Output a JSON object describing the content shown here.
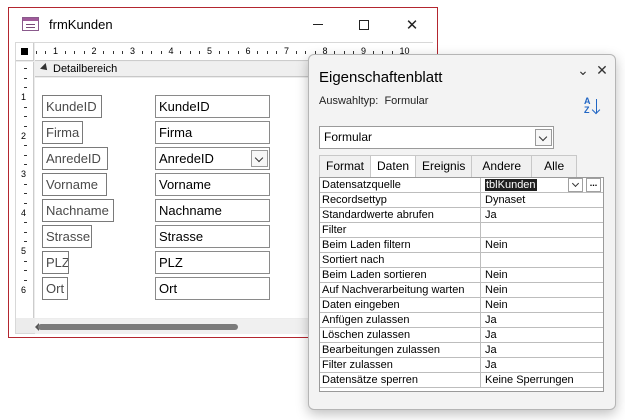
{
  "form_window": {
    "title": "frmKunden",
    "section": "Detailbereich",
    "ruler_h": [
      "1",
      "2",
      "3",
      "4",
      "5",
      "6",
      "7",
      "8",
      "9",
      "10"
    ],
    "ruler_v": [
      "1",
      "2",
      "3",
      "4",
      "5",
      "6"
    ],
    "labels": [
      "KundeID",
      "Firma",
      "AnredeID",
      "Vorname",
      "Nachname",
      "Strasse",
      "PLZ",
      "Ort"
    ],
    "fields": [
      "KundeID",
      "Firma",
      "AnredeID",
      "Vorname",
      "Nachname",
      "Strasse",
      "PLZ",
      "Ort"
    ]
  },
  "property_sheet": {
    "title": "Eigenschaftenblatt",
    "selection_type_label": "Auswahltyp:",
    "selection_type_value": "Formular",
    "sort_icon_text": "A Z",
    "object_select": "Formular",
    "tabs": [
      "Format",
      "Daten",
      "Ereignis",
      "Andere",
      "Alle"
    ],
    "active_tab": "Daten",
    "rows": [
      {
        "name": "Datensatzquelle",
        "value": "tblKunden"
      },
      {
        "name": "Recordsettyp",
        "value": "Dynaset"
      },
      {
        "name": "Standardwerte abrufen",
        "value": "Ja"
      },
      {
        "name": "Filter",
        "value": ""
      },
      {
        "name": "Beim Laden filtern",
        "value": "Nein"
      },
      {
        "name": "Sortiert nach",
        "value": ""
      },
      {
        "name": "Beim Laden sortieren",
        "value": "Nein"
      },
      {
        "name": "Auf Nachverarbeitung warten",
        "value": "Nein"
      },
      {
        "name": "Daten eingeben",
        "value": "Nein"
      },
      {
        "name": "Anfügen zulassen",
        "value": "Ja"
      },
      {
        "name": "Löschen zulassen",
        "value": "Ja"
      },
      {
        "name": "Bearbeitungen zulassen",
        "value": "Ja"
      },
      {
        "name": "Filter zulassen",
        "value": "Ja"
      },
      {
        "name": "Datensätze sperren",
        "value": "Keine Sperrungen"
      }
    ],
    "build_button": "..."
  },
  "colors": {
    "window_border": "#b3262f",
    "selection": "#1f1f1f",
    "accent": "#2166c4"
  }
}
